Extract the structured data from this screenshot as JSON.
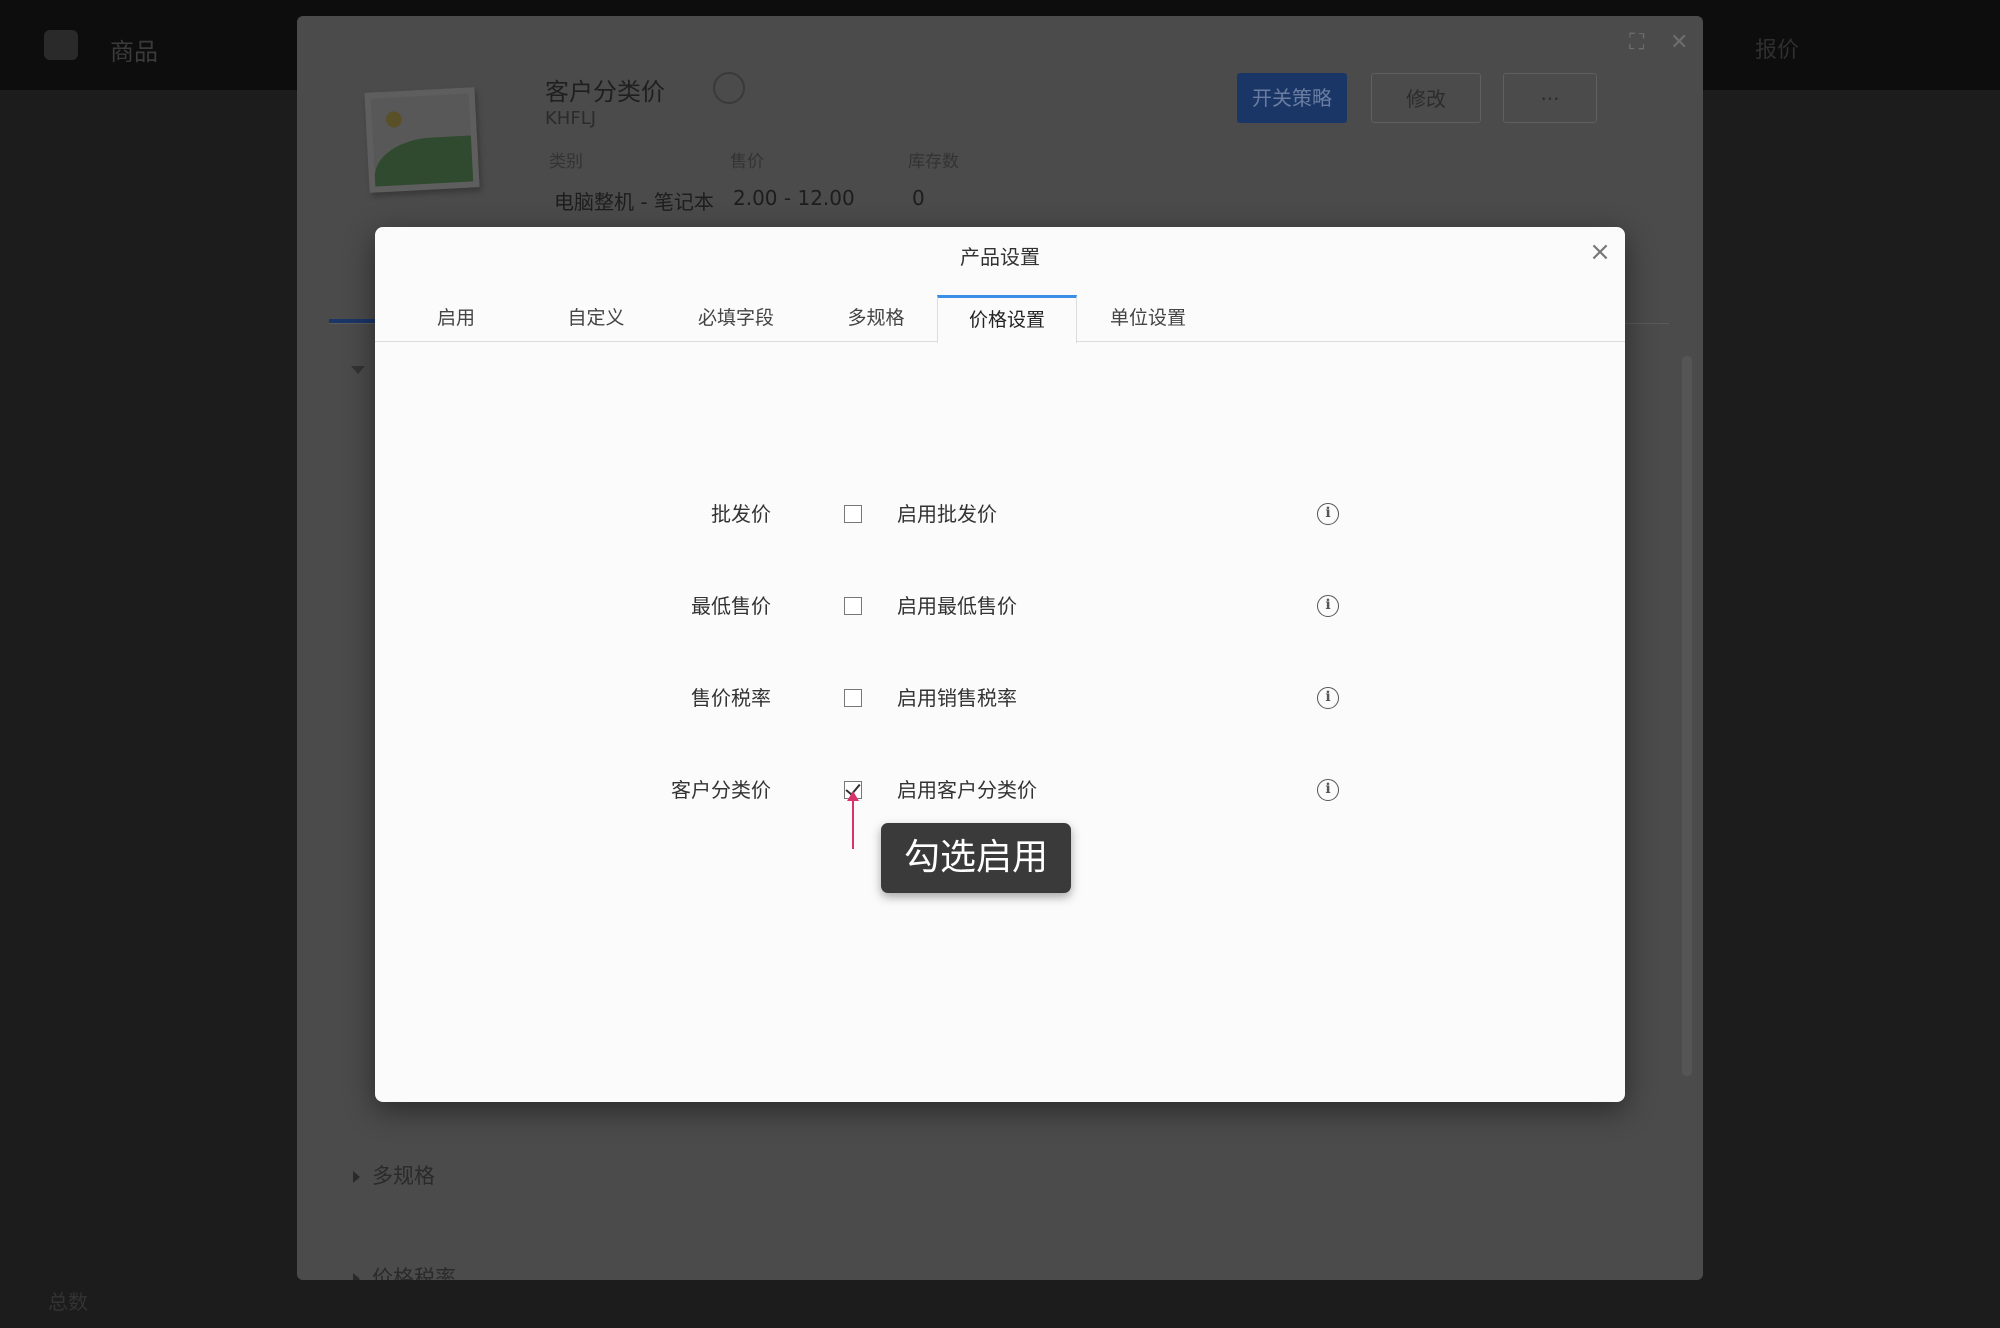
{
  "app": {
    "name": "商品",
    "top_right": "报价",
    "bottom_text": "总数"
  },
  "product": {
    "title": "客户分类价",
    "code": "KHFLJ",
    "meta": [
      {
        "label": "类别",
        "value": "电脑整机 - 笔记本"
      },
      {
        "label": "售价",
        "value": "2.00 - 12.00"
      },
      {
        "label": "库存数",
        "value": "0"
      }
    ],
    "buttons": {
      "strategy": "开关策略",
      "edit": "修改",
      "more": "···"
    },
    "sections": [
      "多规格",
      "价格税率"
    ],
    "icons": [
      "chat-icon",
      "fullscreen-icon",
      "close-icon"
    ]
  },
  "dialog": {
    "title": "产品设置",
    "close": "×",
    "tabs": [
      {
        "label": "启用",
        "active": false
      },
      {
        "label": "自定义",
        "active": false
      },
      {
        "label": "必填字段",
        "active": false
      },
      {
        "label": "多规格",
        "active": false
      },
      {
        "label": "价格设置",
        "active": true
      },
      {
        "label": "单位设置",
        "active": false
      }
    ],
    "settings": [
      {
        "label": "批发价",
        "option": "启用批发价",
        "checked": false
      },
      {
        "label": "最低售价",
        "option": "启用最低售价",
        "checked": false
      },
      {
        "label": "售价税率",
        "option": "启用销售税率",
        "checked": false
      },
      {
        "label": "客户分类价",
        "option": "启用客户分类价",
        "checked": true
      }
    ],
    "info_glyph": "i"
  },
  "annotation": {
    "callout": "勾选启用",
    "arrow_color": "#d8336d"
  },
  "colors": {
    "active_tab_accent": "#3a8ee6",
    "primary_button": "#1a3667"
  }
}
